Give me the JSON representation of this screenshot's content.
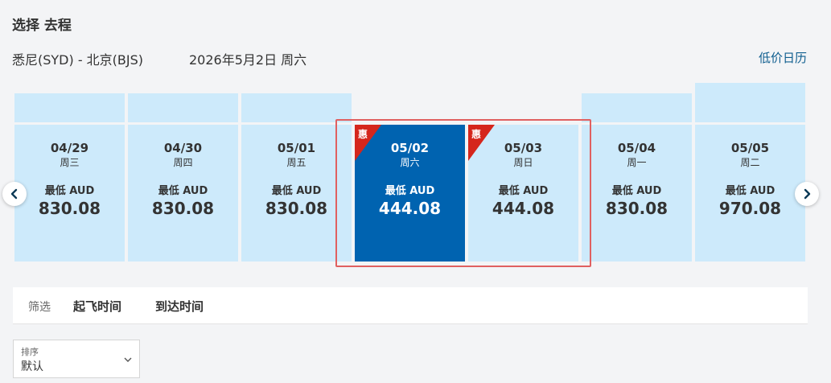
{
  "header": {
    "title": "选择 去程"
  },
  "route": {
    "text": "悉尼(SYD) - 北京(BJS)",
    "date": "2026年5月2日 周六"
  },
  "links": {
    "low_price_calendar": "低价日历"
  },
  "cards": [
    {
      "date": "04/29",
      "weekday": "周三",
      "label": "最低 AUD",
      "price": "830.08",
      "promo": "",
      "selected": false
    },
    {
      "date": "04/30",
      "weekday": "周四",
      "label": "最低 AUD",
      "price": "830.08",
      "promo": "",
      "selected": false
    },
    {
      "date": "05/01",
      "weekday": "周五",
      "label": "最低 AUD",
      "price": "830.08",
      "promo": "",
      "selected": false
    },
    {
      "date": "05/02",
      "weekday": "周六",
      "label": "最低 AUD",
      "price": "444.08",
      "promo": "惠",
      "selected": true
    },
    {
      "date": "05/03",
      "weekday": "周日",
      "label": "最低 AUD",
      "price": "444.08",
      "promo": "惠",
      "selected": false
    },
    {
      "date": "05/04",
      "weekday": "周一",
      "label": "最低 AUD",
      "price": "830.08",
      "promo": "",
      "selected": false
    },
    {
      "date": "05/05",
      "weekday": "周二",
      "label": "最低 AUD",
      "price": "970.08",
      "promo": "",
      "selected": false
    }
  ],
  "filters": {
    "label": "筛选",
    "departure_time": "起飞时间",
    "arrival_time": "到达时间"
  },
  "sort": {
    "label": "排序",
    "value": "默认"
  },
  "icons": {
    "prev": "chevron-left-icon",
    "next": "chevron-right-icon",
    "dropdown": "chevron-down-icon"
  },
  "colors": {
    "selected": "#0063b0",
    "card": "#cdeafb",
    "promo": "#d5261c",
    "highlight_border": "#e06060",
    "link": "#0f5e8f"
  }
}
